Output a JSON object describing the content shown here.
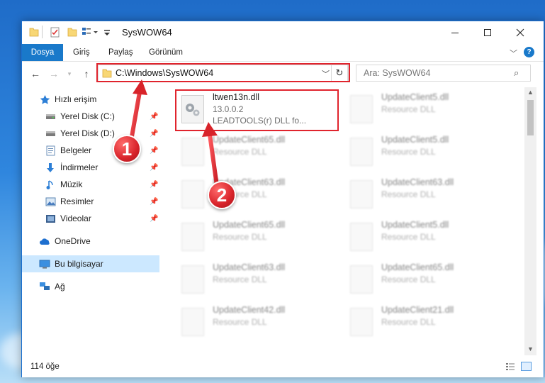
{
  "window": {
    "title": "SysWOW64",
    "controls": [
      "minimize-icon",
      "maximize-icon",
      "close-icon"
    ]
  },
  "ribbon": {
    "tabs": [
      {
        "label": "Dosya",
        "active": true
      },
      {
        "label": "Giriş"
      },
      {
        "label": "Paylaş"
      },
      {
        "label": "Görünüm"
      }
    ]
  },
  "address": {
    "path": "C:\\Windows\\SysWOW64",
    "search_placeholder": "Ara: SysWOW64"
  },
  "sidebar": {
    "items": [
      {
        "label": "Hızlı erişim",
        "icon": "star-icon",
        "pinned": false
      },
      {
        "label": "Yerel Disk (C:)",
        "icon": "drive-icon",
        "pinned": true
      },
      {
        "label": "Yerel Disk (D:)",
        "icon": "drive-icon",
        "pinned": true
      },
      {
        "label": "Belgeler",
        "icon": "documents-icon",
        "pinned": true
      },
      {
        "label": "İndirmeler",
        "icon": "download-icon",
        "pinned": true
      },
      {
        "label": "Müzik",
        "icon": "music-icon",
        "pinned": true
      },
      {
        "label": "Resimler",
        "icon": "pictures-icon",
        "pinned": true
      },
      {
        "label": "Videolar",
        "icon": "videos-icon",
        "pinned": true
      },
      {
        "label": "OneDrive",
        "icon": "cloud-icon",
        "pinned": false
      },
      {
        "label": "Bu bilgisayar",
        "icon": "computer-icon",
        "pinned": false,
        "selected": true
      },
      {
        "label": "Ağ",
        "icon": "network-icon",
        "pinned": false
      }
    ]
  },
  "files": [
    {
      "name": "ltwen13n.dll",
      "line1": "13.0.0.2",
      "line2": "LEADTOOLS(r) DLL fo...",
      "highlighted": true
    },
    {
      "name": "UpdateClient5.dll",
      "line1": "Resource DLL",
      "line2": ""
    },
    {
      "name": "UpdateClient65.dll",
      "line1": "Resource DLL",
      "line2": ""
    },
    {
      "name": "UpdateClient5.dll",
      "line1": "Resource DLL",
      "line2": ""
    },
    {
      "name": "UpdateClient63.dll",
      "line1": "Resource DLL",
      "line2": ""
    },
    {
      "name": "UpdateClient63.dll",
      "line1": "Resource DLL",
      "line2": ""
    },
    {
      "name": "UpdateClient65.dll",
      "line1": "Resource DLL",
      "line2": ""
    },
    {
      "name": "UpdateClient5.dll",
      "line1": "Resource DLL",
      "line2": ""
    },
    {
      "name": "UpdateClient63.dll",
      "line1": "Resource DLL",
      "line2": ""
    },
    {
      "name": "UpdateClient65.dll",
      "line1": "Resource DLL",
      "line2": ""
    },
    {
      "name": "UpdateClient42.dll",
      "line1": "Resource DLL",
      "line2": ""
    },
    {
      "name": "UpdateClient21.dll",
      "line1": "Resource DLL",
      "line2": ""
    }
  ],
  "status": {
    "count": "114 öğe"
  },
  "callouts": {
    "step1": "1",
    "step2": "2"
  },
  "colors": {
    "accent": "#1979ca",
    "highlight": "#e0242d",
    "selection": "#cce8ff"
  }
}
